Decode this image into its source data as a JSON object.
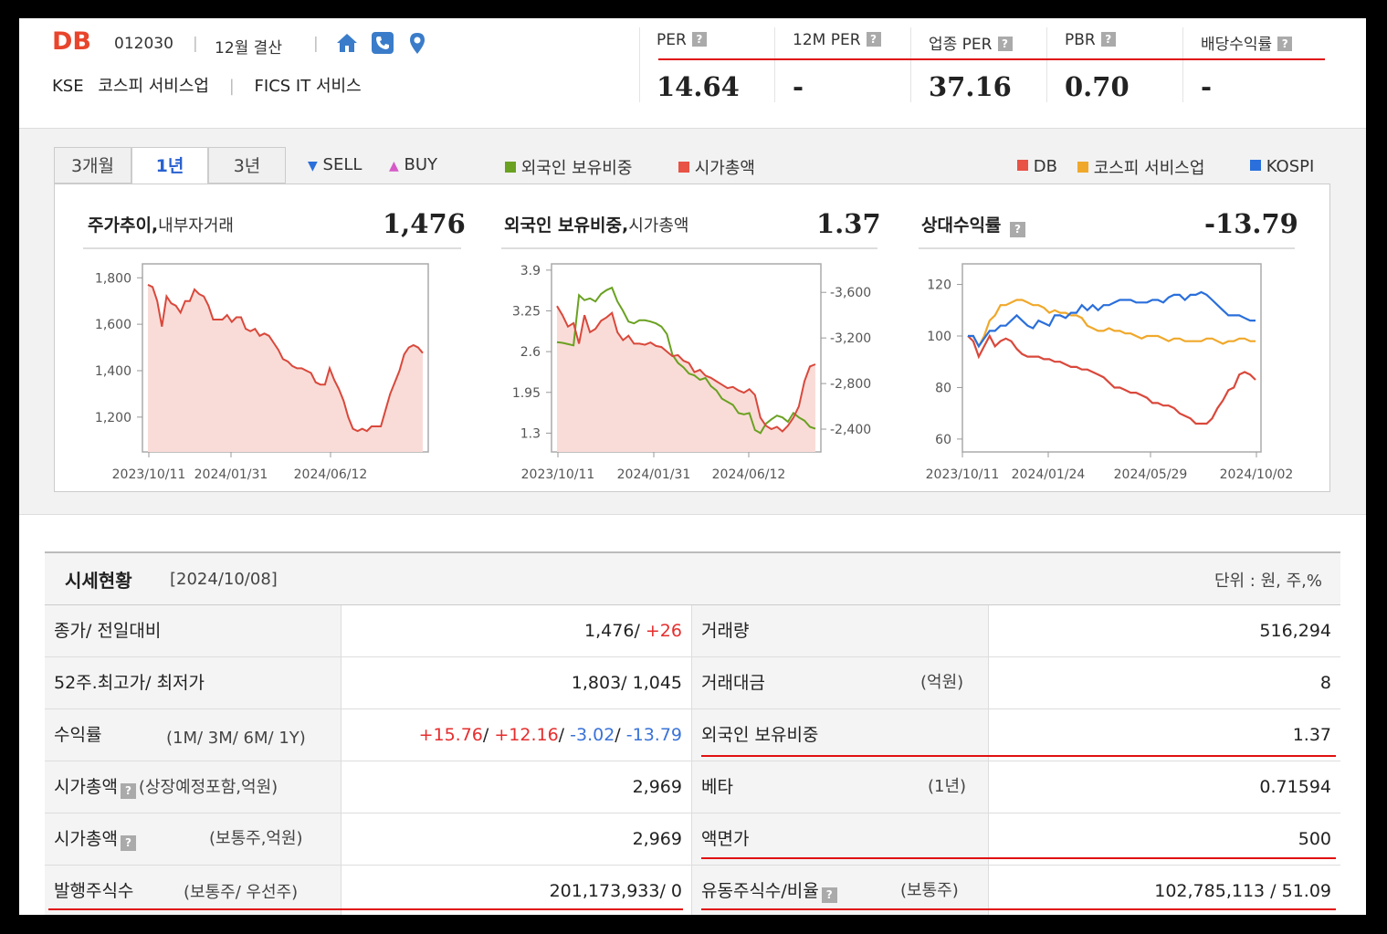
{
  "header": {
    "name": "DB",
    "code": "012030",
    "fiscal": "12월 결산",
    "market": "KSE",
    "sector": "코스피 서비스업",
    "fics": "FICS IT 서비스"
  },
  "ratios": [
    {
      "label": "PER",
      "value": "14.64"
    },
    {
      "label": "12M PER",
      "value": "-"
    },
    {
      "label": "업종 PER",
      "value": "37.16"
    },
    {
      "label": "PBR",
      "value": "0.70"
    },
    {
      "label": "배당수익률",
      "value": "-"
    }
  ],
  "tabs": [
    "3개월",
    "1년",
    "3년"
  ],
  "active_tab": "1년",
  "legend": {
    "sell": "SELL",
    "buy": "BUY",
    "foreign": "외국인 보유비중",
    "mcap": "시가총액",
    "db": "DB",
    "sector": "코스피 서비스업",
    "kospi": "KOSPI"
  },
  "colors": {
    "brand": "#e8452c",
    "db_line": "#d9483b",
    "foreign_line": "#6aa121",
    "sector_line": "#f0a82a",
    "kospi_line": "#2a6fdb",
    "sell": "#2a6fdb",
    "buy": "#d659c8"
  },
  "panels": {
    "price": {
      "title": "주가추이",
      "subtitle": "내부자거래",
      "value": "1,476"
    },
    "foreign": {
      "title": "외국인 보유비중",
      "subtitle": "시가총액",
      "value": "1.37"
    },
    "relative": {
      "title": "상대수익률",
      "value": "-13.79"
    }
  },
  "chart_data": [
    {
      "type": "area",
      "title": "주가추이",
      "x_ticks": [
        "2023/10/11",
        "2024/01/31",
        "2024/06/12"
      ],
      "y_ticks": [
        "1,800",
        "1,600",
        "1,400",
        "1,200"
      ],
      "ylim": [
        1050,
        1860
      ],
      "series": [
        {
          "values": [
            1770,
            1760,
            1700,
            1590,
            1720,
            1690,
            1680,
            1650,
            1700,
            1700,
            1750,
            1730,
            1720,
            1680,
            1620,
            1620,
            1620,
            1640,
            1610,
            1630,
            1630,
            1580,
            1570,
            1580,
            1550,
            1560,
            1550,
            1520,
            1490,
            1450,
            1440,
            1420,
            1410,
            1410,
            1400,
            1390,
            1350,
            1340,
            1340,
            1410,
            1360,
            1320,
            1270,
            1200,
            1150,
            1140,
            1150,
            1140,
            1160,
            1160,
            1160,
            1230,
            1300,
            1350,
            1400,
            1470,
            1500,
            1510,
            1500,
            1476
          ]
        }
      ]
    },
    {
      "type": "line",
      "title": "외국인 보유비중",
      "x_ticks": [
        "2023/10/11",
        "2024/01/31",
        "2024/06/12"
      ],
      "y_ticks": [
        "3.9",
        "3.25",
        "2.6",
        "1.95",
        "1.3"
      ],
      "y2_ticks": [
        "3,600",
        "3,200",
        "2,800",
        "2,400"
      ],
      "ylim": [
        1.0,
        4.0
      ],
      "series": [
        {
          "name": "외국인 보유비중",
          "values": [
            2.75,
            2.74,
            2.72,
            2.7,
            3.5,
            3.42,
            3.45,
            3.4,
            3.52,
            3.58,
            3.62,
            3.4,
            3.25,
            3.08,
            3.05,
            3.1,
            3.1,
            3.08,
            3.05,
            3.0,
            2.88,
            2.55,
            2.42,
            2.35,
            2.25,
            2.22,
            2.15,
            2.18,
            2.05,
            1.98,
            1.85,
            1.8,
            1.75,
            1.62,
            1.6,
            1.62,
            1.35,
            1.3,
            1.45,
            1.52,
            1.58,
            1.55,
            1.48,
            1.62,
            1.55,
            1.5,
            1.4,
            1.37
          ]
        },
        {
          "name": "시가총액",
          "values": [
            3480,
            3400,
            3300,
            3330,
            3150,
            3400,
            3250,
            3280,
            3350,
            3380,
            3420,
            3250,
            3180,
            3220,
            3150,
            3150,
            3140,
            3160,
            3130,
            3120,
            3080,
            3040,
            3050,
            3000,
            2980,
            2900,
            2920,
            2870,
            2850,
            2820,
            2790,
            2760,
            2770,
            2740,
            2720,
            2750,
            2700,
            2500,
            2430,
            2400,
            2420,
            2380,
            2430,
            2500,
            2600,
            2820,
            2950,
            2969
          ]
        }
      ]
    },
    {
      "type": "line",
      "title": "상대수익률",
      "x_ticks": [
        "2023/10/11",
        "2024/01/24",
        "2024/05/29",
        "2024/10/02"
      ],
      "y_ticks": [
        "120",
        "100",
        "80",
        "60"
      ],
      "ylim": [
        55,
        128
      ],
      "series": [
        {
          "name": "DB",
          "values": [
            100,
            98,
            92,
            96,
            100,
            96,
            98,
            99,
            98,
            95,
            93,
            92,
            92,
            92,
            91,
            91,
            90,
            90,
            89,
            88,
            88,
            87,
            87,
            86,
            85,
            84,
            82,
            80,
            80,
            79,
            78,
            78,
            77,
            76,
            74,
            74,
            73,
            73,
            72,
            70,
            69,
            68,
            66,
            66,
            66,
            68,
            72,
            75,
            79,
            80,
            85,
            86,
            85,
            83
          ]
        },
        {
          "name": "코스피 서비스업",
          "values": [
            100,
            100,
            96,
            100,
            106,
            108,
            112,
            112,
            113,
            114,
            114,
            113,
            112,
            112,
            111,
            109,
            110,
            109,
            109,
            108,
            108,
            107,
            104,
            103,
            102,
            102,
            103,
            102,
            102,
            101,
            101,
            100,
            99,
            100,
            100,
            100,
            99,
            98,
            99,
            99,
            98,
            98,
            98,
            98,
            99,
            99,
            98,
            97,
            98,
            98,
            99,
            99,
            98,
            98
          ]
        },
        {
          "name": "KOSPI",
          "values": [
            100,
            100,
            96,
            99,
            102,
            102,
            104,
            104,
            106,
            108,
            106,
            104,
            103,
            106,
            105,
            104,
            108,
            108,
            107,
            109,
            109,
            112,
            110,
            112,
            110,
            112,
            112,
            113,
            114,
            114,
            114,
            113,
            113,
            113,
            114,
            114,
            113,
            115,
            116,
            116,
            114,
            116,
            116,
            117,
            116,
            114,
            112,
            110,
            108,
            108,
            108,
            107,
            106,
            106
          ]
        }
      ]
    }
  ],
  "table": {
    "title": "시세현황",
    "date": "[2024/10/08]",
    "unit": "단위 : 원, 주,%",
    "rows": [
      {
        "l1": "종가/ 전일대비",
        "v1a": "1,476/ ",
        "v1b": "+26",
        "l2": "거래량",
        "v2": "516,294"
      },
      {
        "l1": "52주.최고가/ 최저가",
        "v1": "1,803/ 1,045",
        "l2": "거래대금",
        "n2": "(억원)",
        "v2": "8"
      },
      {
        "l1": "수익률",
        "n1": "(1M/ 3M/ 6M/ 1Y)",
        "r1": "+15.76",
        "r2": "+12.16",
        "r3": "-3.02",
        "r4": "-13.79",
        "l2": "외국인 보유비중",
        "v2": "1.37"
      },
      {
        "l1": "시가총액",
        "n1": "(상장예정포함,억원)",
        "v1": "2,969",
        "l2": "베타",
        "n2": "(1년)",
        "v2": "0.71594"
      },
      {
        "l1": "시가총액",
        "n1": "(보통주,억원)",
        "v1": "2,969",
        "l2": "액면가",
        "v2": "500"
      },
      {
        "l1": "발행주식수",
        "n1": "(보통주/ 우선주)",
        "v1": "201,173,933/ 0",
        "l2": "유동주식수/비율",
        "n2": "(보통주)",
        "v2": "102,785,113 / 51.09"
      }
    ]
  }
}
